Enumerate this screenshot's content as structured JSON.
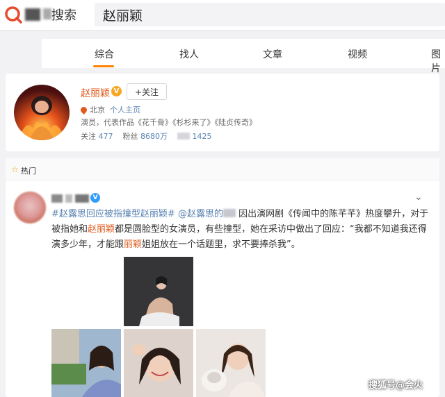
{
  "app": {
    "site_label": "搜索",
    "search_value": "赵丽颖"
  },
  "tabs": [
    "综合",
    "找人",
    "文章",
    "视频",
    "图片"
  ],
  "user": {
    "name": "赵丽颖",
    "verified": "V",
    "follow_label": "+关注",
    "location": "北京",
    "homepage_link": "个人主页",
    "bio": "演员，代表作品《花千骨》《杉杉来了》《陆贞传奇》",
    "following_label": "关注",
    "following_count": "477",
    "fans_label": "粉丝",
    "fans_count": "8680万",
    "posts_count": "1425"
  },
  "hot": {
    "label": "热门",
    "post": {
      "hashtag1": "#赵露思回应被指撞型赵丽颖#",
      "mention": "@赵露思的",
      "text1": "因出演网剧《传闻中的陈芊芊》热度攀升，对于被指她和",
      "hl1": "赵丽颖",
      "text2": "都是圆脸型的女演员，有些撞型，她在采访中做出了回应：“我都不知道我还得演多少年，才能跟",
      "hl2": "丽颖",
      "text3": "姐姐放在一个话题里，求不要捧杀我”。"
    }
  },
  "watermark": "搜狐号@会火",
  "colors": {
    "accent": "#ff8200",
    "highlight": "#e05a1c",
    "link": "#5882b2"
  }
}
